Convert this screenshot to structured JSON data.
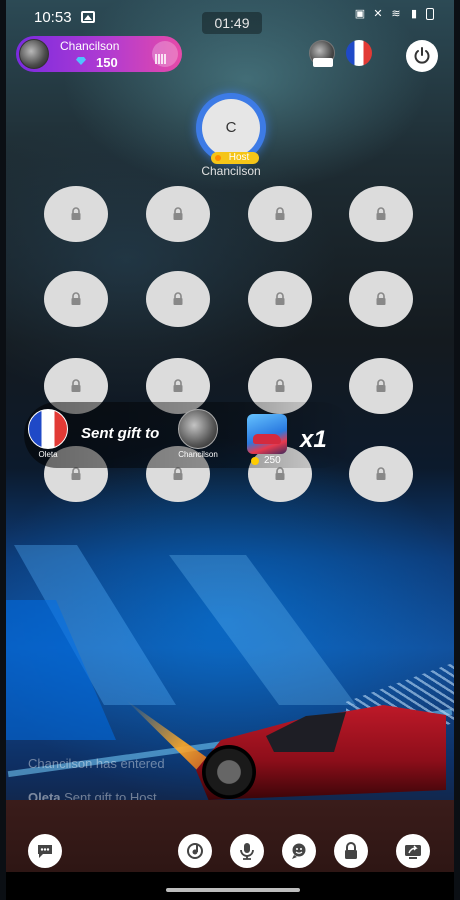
{
  "status_bar": {
    "time": "10:53"
  },
  "room": {
    "timer": "01:49"
  },
  "host_card": {
    "name": "Chancilson",
    "coins": "150"
  },
  "host_seat": {
    "initial": "C",
    "badge": "Host",
    "name": "Chancilson"
  },
  "seats": [
    {
      "state": "locked"
    },
    {
      "state": "locked"
    },
    {
      "state": "locked"
    },
    {
      "state": "locked"
    },
    {
      "state": "locked"
    },
    {
      "state": "locked"
    },
    {
      "state": "locked"
    },
    {
      "state": "locked"
    },
    {
      "state": "locked"
    },
    {
      "state": "locked"
    },
    {
      "state": "locked"
    },
    {
      "state": "locked"
    },
    {
      "state": "locked"
    },
    {
      "state": "locked"
    },
    {
      "state": "locked"
    },
    {
      "state": "locked"
    }
  ],
  "gift_banner": {
    "sender_name": "Oleta",
    "text": "Sent gift to",
    "recipient_name": "Chancilson",
    "gift_price": "250",
    "multiplier": "x1"
  },
  "chat": [
    {
      "user": "",
      "text": "Chancilson has entered"
    },
    {
      "user": "Oleta",
      "text": "Sent gift to Host"
    }
  ],
  "toolbar": {
    "icons": [
      "chat-icon",
      "music-icon",
      "mic-icon",
      "face-icon",
      "lock-icon",
      "share-screen-icon"
    ]
  },
  "colors": {
    "host_card_start": "#7a2be0",
    "host_card_end": "#e64aa8",
    "host_ring": "#3d7be6",
    "host_badge": "#f5c518"
  }
}
